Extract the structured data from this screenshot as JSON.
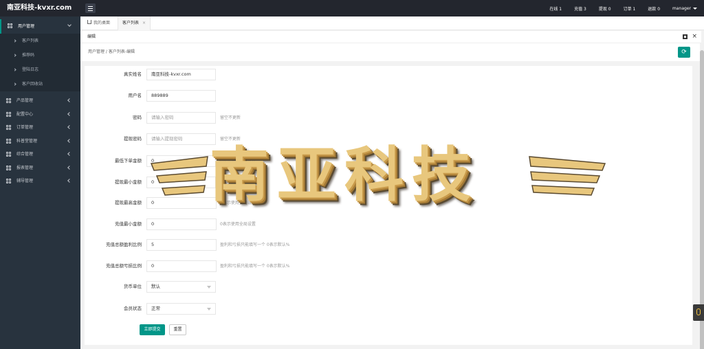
{
  "app": {
    "brand": "南亚科技-kvxr.com"
  },
  "topbar": {
    "stats": [
      {
        "label": "在线 1"
      },
      {
        "label": "充值 3"
      },
      {
        "label": "提现 0"
      },
      {
        "label": "订单 1"
      },
      {
        "label": "退款 0"
      }
    ],
    "user": "manager"
  },
  "sidebar": {
    "active_group": "用户管理",
    "active_subitems": [
      "客户列表",
      "推荐码",
      "登陆日志",
      "客户回收站"
    ],
    "groups": [
      "产品管理",
      "配置中心",
      "订单管理",
      "科普堂管理",
      "综合管理",
      "报表管理",
      "辅导管理"
    ]
  },
  "tabs": [
    {
      "label": "我的桌面"
    },
    {
      "label": "客户列表",
      "close": "×"
    }
  ],
  "panel": {
    "title": "编辑",
    "breadcrumb": "用户管理 / 客户列表-编辑"
  },
  "form": {
    "fields": [
      {
        "label": "真实姓名",
        "value": "南亚科技-kvxr.com",
        "placeholder": "",
        "hint": ""
      },
      {
        "label": "用户名",
        "value": "889889",
        "placeholder": "",
        "hint": ""
      },
      {
        "label": "密码",
        "value": "",
        "placeholder": "请输入密码",
        "hint": "留空不更新"
      },
      {
        "label": "提现密码",
        "value": "",
        "placeholder": "请输入提现密码",
        "hint": "留空不更新"
      },
      {
        "label": "最低下单金额",
        "value": "0",
        "placeholder": "",
        "hint": "0表示使用全局设置"
      },
      {
        "label": "提现最小金额",
        "value": "0",
        "placeholder": "",
        "hint": "0表示使用全局设置"
      },
      {
        "label": "提现最高金额",
        "value": "0",
        "placeholder": "",
        "hint": "0表示使用全局设置"
      },
      {
        "label": "充值最小金额",
        "value": "0",
        "placeholder": "",
        "hint": "0表示使用全局设置"
      },
      {
        "label": "充值总额盈利比例",
        "value": "5",
        "placeholder": "",
        "hint": "盈利和亏损只能填写一个 0表示默认%"
      },
      {
        "label": "充值总额亏损比例",
        "value": "0",
        "placeholder": "",
        "hint": "盈利和亏损只能填写一个 0表示默认%"
      }
    ],
    "selects": [
      {
        "label": "货币单位",
        "value": "默认"
      },
      {
        "label": "会员状态",
        "value": "正常"
      }
    ],
    "submit_label": "立即提交",
    "reset_label": "重置"
  },
  "watermark": {
    "text": "南亚科技"
  },
  "colors": {
    "accent": "#009688",
    "topbar": "#23262e",
    "sidebar": "#28333e"
  }
}
